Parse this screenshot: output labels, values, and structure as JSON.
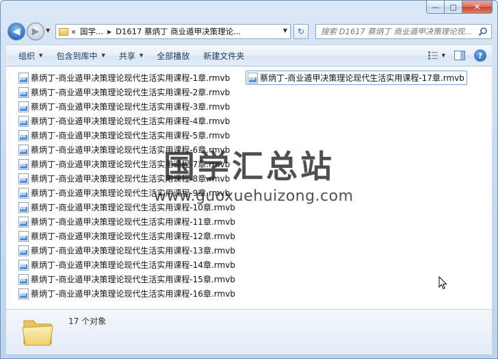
{
  "window": {
    "minimize_glyph": "—",
    "maximize_glyph": "□",
    "close_glyph": "✕"
  },
  "nav": {
    "address": {
      "overflow": "«",
      "crumbs": [
        "国学...",
        "D1617 蔡炳丁 商业遁甲决策理论..."
      ]
    },
    "search": {
      "placeholder": "搜索 D1617 蔡炳丁 商业遁甲决策理论现..."
    }
  },
  "toolbar": {
    "organize": "组织",
    "include_in_library": "包含到库中",
    "share": "共享",
    "play_all": "全部播放",
    "new_folder": "新建文件夹"
  },
  "files": {
    "column1": [
      "蔡炳丁-商业遁甲决策理论现代生活实用课程-1章.rmvb",
      "蔡炳丁-商业遁甲决策理论现代生活实用课程-2章.rmvb",
      "蔡炳丁-商业遁甲决策理论现代生活实用课程-3章.rmvb",
      "蔡炳丁-商业遁甲决策理论现代生活实用课程-4章.rmvb",
      "蔡炳丁-商业遁甲决策理论现代生活实用课程-5章.rmvb",
      "蔡炳丁-商业遁甲决策理论现代生活实用课程-6章.rmvb",
      "蔡炳丁-商业遁甲决策理论现代生活实用课程-7章.rmvb",
      "蔡炳丁-商业遁甲决策理论现代生活实用课程-8章.rmvb",
      "蔡炳丁-商业遁甲决策理论现代生活实用课程-9章.rmvb",
      "蔡炳丁-商业遁甲决策理论现代生活实用课程-10章.rmvb",
      "蔡炳丁-商业遁甲决策理论现代生活实用课程-11章.rmvb",
      "蔡炳丁-商业遁甲决策理论现代生活实用课程-12章.rmvb",
      "蔡炳丁-商业遁甲决策理论现代生活实用课程-13章.rmvb",
      "蔡炳丁-商业遁甲决策理论现代生活实用课程-14章.rmvb",
      "蔡炳丁-商业遁甲决策理论现代生活实用课程-15章.rmvb",
      "蔡炳丁-商业遁甲决策理论现代生活实用课程-16章.rmvb"
    ],
    "column2": [
      "蔡炳丁-商业遁甲决策理论现代生活实用课程-17章.rmvb"
    ]
  },
  "watermark": {
    "chinese": "国学汇总站",
    "url": "www.guoxuehuizong.com"
  },
  "details": {
    "count_text": "17 个对象"
  }
}
